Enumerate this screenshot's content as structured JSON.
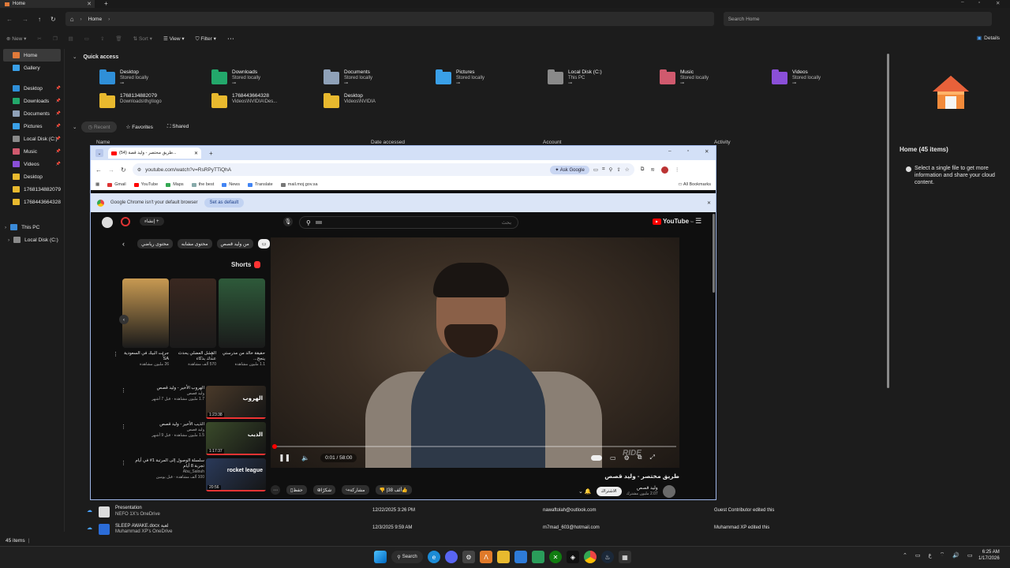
{
  "explorer": {
    "tab_title": "Home",
    "breadcrumb": "Home",
    "search_placeholder": "Search Home",
    "toolbar": {
      "new": "New",
      "sort": "Sort",
      "view": "View",
      "filter": "Filter",
      "details": "Details"
    },
    "sidebar": {
      "top": [
        {
          "label": "Home",
          "icon": "home-icon"
        },
        {
          "label": "Gallery",
          "icon": "gallery-icon"
        }
      ],
      "pinned": [
        {
          "label": "Desktop",
          "color": "#2f8fd8"
        },
        {
          "label": "Downloads",
          "color": "#23a86b"
        },
        {
          "label": "Documents",
          "color": "#8fa1b8"
        },
        {
          "label": "Pictures",
          "color": "#3aa0e8"
        },
        {
          "label": "Local Disk (C:)",
          "color": "#8a8a8a"
        },
        {
          "label": "Music",
          "color": "#d05a6e"
        },
        {
          "label": "Videos",
          "color": "#8a4fd8"
        },
        {
          "label": "Desktop",
          "color": "#e8b92e"
        },
        {
          "label": "1768134882079",
          "color": "#e8b92e"
        },
        {
          "label": "1768443664328",
          "color": "#e8b92e"
        }
      ],
      "this_pc": "This PC",
      "local_disk": "Local Disk (C:)"
    },
    "quick_access_label": "Quick access",
    "quick_access": [
      {
        "name": "Desktop",
        "sub": "Stored locally",
        "color": "#2f8fd8"
      },
      {
        "name": "Downloads",
        "sub": "Stored locally",
        "color": "#23a86b"
      },
      {
        "name": "Documents",
        "sub": "Stored locally",
        "color": "#8fa1b8"
      },
      {
        "name": "Pictures",
        "sub": "Stored locally",
        "color": "#3aa0e8"
      },
      {
        "name": "Local Disk (C:)",
        "sub": "This PC",
        "color": "#8a8a8a"
      },
      {
        "name": "Music",
        "sub": "Stored locally",
        "color": "#d05a6e"
      },
      {
        "name": "Videos",
        "sub": "Stored locally",
        "color": "#8a4fd8"
      },
      {
        "name": "1768134882079",
        "sub": "Downloads\\thg\\logo",
        "color": "#e8b92e"
      },
      {
        "name": "1768443664328",
        "sub": "Videos\\NVIDIA\\Des...",
        "color": "#e8b92e"
      },
      {
        "name": "Desktop",
        "sub": "Videos\\NVIDIA",
        "color": "#e8b92e"
      }
    ],
    "filter_tabs": {
      "recent": "Recent",
      "favorites": "Favorites",
      "shared": "Shared"
    },
    "columns": {
      "name": "Name",
      "date": "Date accessed",
      "account": "Account",
      "activity": "Activity"
    },
    "recent_files": [
      {
        "name": "Presentation",
        "sub": "NEFO 1X's OneDrive",
        "date": "12/22/2025 3:26 PM",
        "account": "nawaftolah@outlook.com",
        "activity": "Guest Contributor edited this"
      },
      {
        "name": "SLEEP AWAKE.docx لعبة",
        "sub": "Muhammad XP's OneDrive",
        "date": "12/3/2025 9:59 AM",
        "account": "m7mad_603@hotmail.com",
        "activity": "Muhammad XP edited this"
      }
    ],
    "status": "45 items",
    "details_title": "Home (45 items)",
    "details_text": "Select a single file to get more information and share your cloud content."
  },
  "chrome": {
    "tab_title": "(54) طريق مختصر - وليد قصة...",
    "url": "youtube.com/watch?v=RsRPyTTiQhA",
    "ask_google": "Ask Google",
    "bookmarks": [
      "Gmail",
      "YouTube",
      "Maps",
      "the best",
      "News",
      "Translate",
      "mail.moj.gov.sa"
    ],
    "all_bookmarks": "All Bookmarks",
    "infobar_text": "Google Chrome isn't your default browser",
    "set_default": "Set as default"
  },
  "youtube": {
    "search_placeholder": "بحث",
    "create": "إنشاء",
    "logo": "YouTube",
    "region": "SA",
    "chips": [
      "من وليد قصص",
      "محتوى مشابه",
      "محتوى رياضي"
    ],
    "shorts_title": "Shorts",
    "shorts": [
      {
        "title": "حقيقة خالد من مدرستي ينجح...",
        "views": "1.1 مليون مشاهدة"
      },
      {
        "title": "الفشل العضلي يحدث عندك بذكاء",
        "views": "570 ألف مشاهدة"
      },
      {
        "title": "جربت البيك في السعودية SA",
        "views": "26 مليون مشاهدة"
      }
    ],
    "related": [
      {
        "title": "الهروب الأخير - وليد قصص",
        "channel": "وليد قصص",
        "meta": "1.7 مليون مشاهدة · قبل 7 أشهر",
        "duration": "1:23:38",
        "thumb_text": "الهروب"
      },
      {
        "title": "الذيب الأخير - وليد قصص",
        "channel": "وليد قصص",
        "meta": "1.5 مليون مشاهدة · قبل 9 أشهر",
        "duration": "1:17:37",
        "thumb_text": "الذيب"
      },
      {
        "title": "سلسلة الوصول إلى المرتبة 1# في أيام تجربة 8 أيام",
        "channel": "Abu_Salouh",
        "meta": "100 ألف مشاهدة · قبل يومين",
        "duration": "20:56",
        "thumb_text": "rocket league"
      }
    ],
    "video_time": "0:01 / 58:00",
    "video_title": "طريق مختصر - وليد قصص",
    "channel": "وليد قصص",
    "subscribers": "2.07 مليون مشترك",
    "subscribe": "الاشتراك",
    "likes": "38 ألف",
    "share": "مشاركة",
    "thanks": "شكرًا",
    "save": "حفظ",
    "watermark": "RIDE"
  },
  "taskbar": {
    "search": "Search",
    "time": "6:25 AM",
    "date": "1/17/2026",
    "lang": "ع"
  }
}
